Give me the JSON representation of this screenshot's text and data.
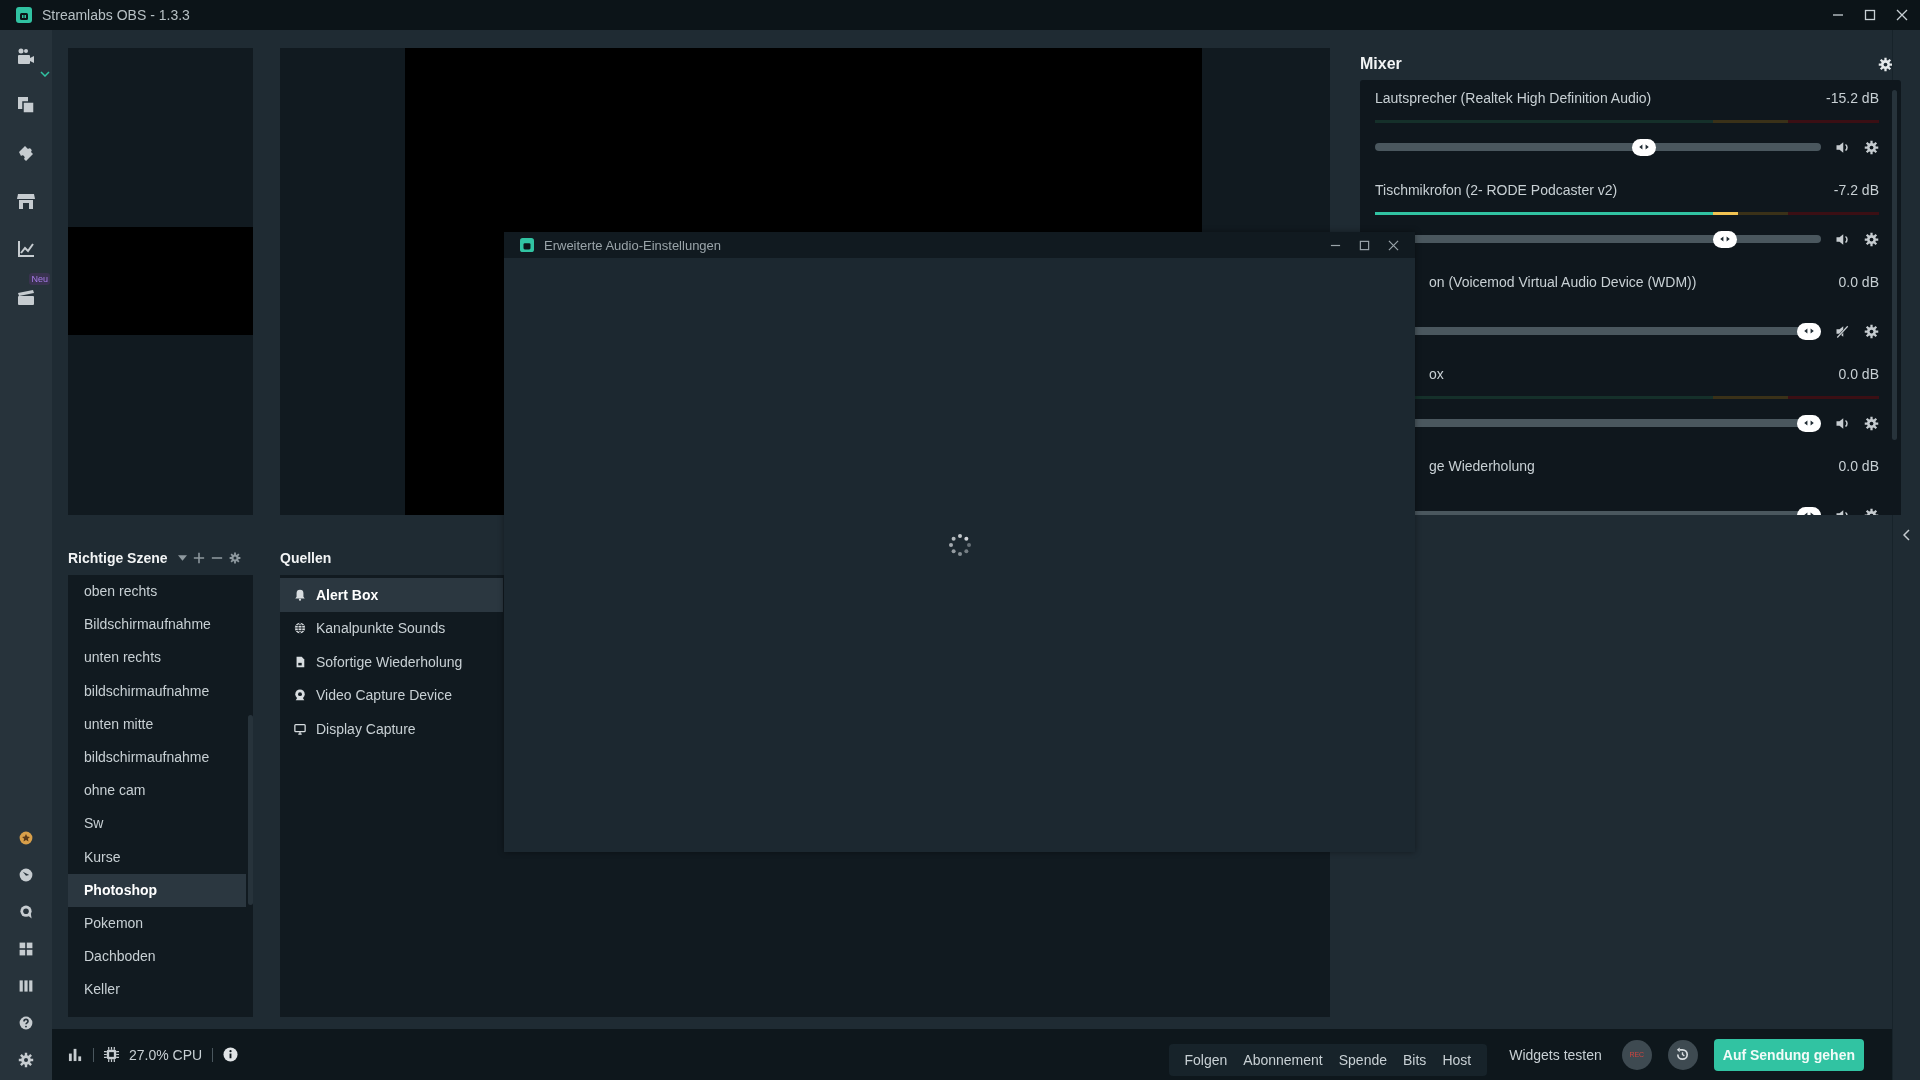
{
  "window": {
    "title": "Streamlabs OBS - 1.3.3"
  },
  "nav": {
    "badge": "Neu"
  },
  "scenes": {
    "title": "Richtige Szene",
    "items": [
      {
        "name": "oben rechts",
        "selected": false
      },
      {
        "name": "Bildschirmaufnahme",
        "selected": false
      },
      {
        "name": "unten rechts",
        "selected": false
      },
      {
        "name": "bildschirmaufnahme",
        "selected": false
      },
      {
        "name": "unten mitte",
        "selected": false
      },
      {
        "name": "bildschirmaufnahme",
        "selected": false
      },
      {
        "name": "ohne cam",
        "selected": false
      },
      {
        "name": "Sw",
        "selected": false
      },
      {
        "name": "Kurse",
        "selected": false
      },
      {
        "name": "Photoshop",
        "selected": true
      },
      {
        "name": "Pokemon",
        "selected": false
      },
      {
        "name": "Dachboden",
        "selected": false
      },
      {
        "name": "Keller",
        "selected": false
      }
    ]
  },
  "sources": {
    "title": "Quellen",
    "items": [
      {
        "name": "Alert Box",
        "kind": "alert",
        "selected": true
      },
      {
        "name": "Kanalpunkte Sounds",
        "kind": "browser",
        "selected": false
      },
      {
        "name": "Sofortige Wiederholung",
        "kind": "media",
        "selected": false
      },
      {
        "name": "Video Capture Device",
        "kind": "camera",
        "selected": false
      },
      {
        "name": "Display Capture",
        "kind": "display",
        "selected": false
      }
    ]
  },
  "mixer": {
    "title": "Mixer",
    "channels": [
      {
        "name": "Lautsprecher (Realtek High Definition Audio)",
        "reading": "-15.2 dB",
        "muted": false,
        "clipped": false,
        "meter": {
          "level": 0
        },
        "volume": {
          "level": 0.61
        }
      },
      {
        "name": "Tischmikrofon (2- RODE Podcaster v2)",
        "reading": "-7.2 dB",
        "muted": false,
        "clipped": false,
        "meter": {
          "level": 0.72
        },
        "volume": {
          "level": 0.8
        }
      },
      {
        "name": "on (Voicemod Virtual Audio Device (WDM))",
        "reading": "0.0 dB",
        "muted": true,
        "clipped": true,
        "volume": {
          "level": 1
        }
      },
      {
        "name": "ox",
        "reading": "0.0 dB",
        "muted": false,
        "clipped": true,
        "meter": {
          "level": 0
        },
        "volume": {
          "level": 1
        }
      },
      {
        "name": "ge Wiederholung",
        "reading": "0.0 dB",
        "muted": false,
        "clipped": true,
        "volume": {
          "level": 1
        }
      }
    ]
  },
  "dialog": {
    "title": "Erweiterte Audio-Einstellungen",
    "loading": true
  },
  "status_bar": {
    "cpu": "27.0% CPU"
  },
  "alert_tests": [
    "Folgen",
    "Abonnement",
    "Spende",
    "Bits",
    "Host"
  ],
  "widgets_label": "Widgets testen",
  "rec_button": "REC",
  "go_live_button": "Auf Sendung gehen"
}
